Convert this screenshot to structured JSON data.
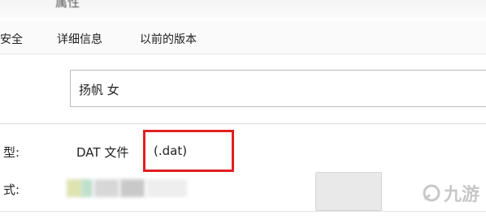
{
  "window": {
    "title": "属性"
  },
  "tabs": [
    {
      "label": "安全"
    },
    {
      "label": "详细信息"
    },
    {
      "label": "以前的版本"
    }
  ],
  "general": {
    "file_name": "扬帆 女",
    "type_label": "型:",
    "type_value_prefix": "DAT 文件",
    "type_value_ext": "(.dat)",
    "open_with_label": "式:"
  },
  "watermark": {
    "text": "九游",
    "icon": "ninegame-logo-icon"
  },
  "colors": {
    "highlight": "#e02020"
  }
}
